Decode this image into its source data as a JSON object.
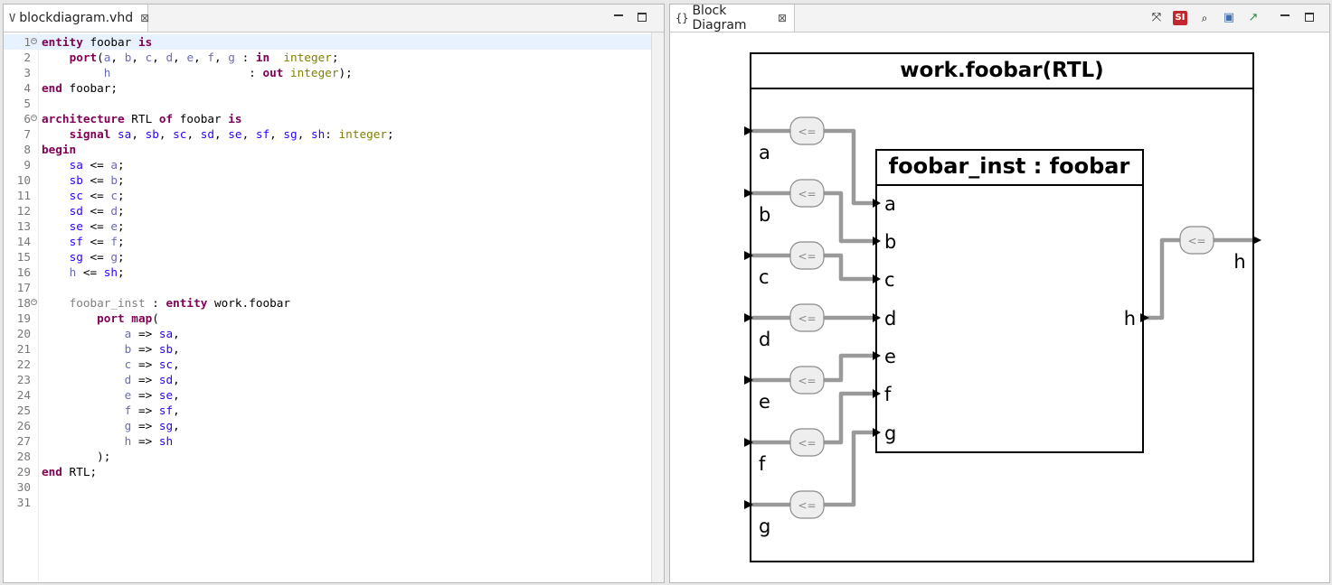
{
  "left_editor": {
    "tab": {
      "title": "blockdiagram.vhd",
      "icon": "vhdl-file-icon"
    },
    "lines": [
      {
        "n": "1",
        "t": [
          [
            "entity",
            "kw"
          ],
          [
            " foobar ",
            ""
          ],
          [
            "is",
            "kw"
          ]
        ]
      },
      {
        "n": "2",
        "t": [
          [
            "    ",
            ""
          ],
          [
            "port",
            "kw"
          ],
          [
            "(",
            ""
          ],
          [
            "a",
            "prt"
          ],
          [
            ", ",
            ""
          ],
          [
            "b",
            "prt"
          ],
          [
            ", ",
            ""
          ],
          [
            "c",
            "prt"
          ],
          [
            ", ",
            ""
          ],
          [
            "d",
            "prt"
          ],
          [
            ", ",
            ""
          ],
          [
            "e",
            "prt"
          ],
          [
            ", ",
            ""
          ],
          [
            "f",
            "prt"
          ],
          [
            ", ",
            ""
          ],
          [
            "g",
            "prt"
          ],
          [
            " : ",
            ""
          ],
          [
            "in",
            "kw"
          ],
          [
            "  ",
            ""
          ],
          [
            "integer",
            "typ"
          ],
          [
            ";",
            ""
          ]
        ]
      },
      {
        "n": "3",
        "t": [
          [
            "         ",
            ""
          ],
          [
            "h",
            "prt"
          ],
          [
            "                    : ",
            ""
          ],
          [
            "out",
            "kw"
          ],
          [
            " ",
            ""
          ],
          [
            "integer",
            "typ"
          ],
          [
            ");",
            ""
          ]
        ]
      },
      {
        "n": "4",
        "t": [
          [
            "end",
            "kw"
          ],
          [
            " foobar;",
            ""
          ]
        ]
      },
      {
        "n": "5",
        "t": []
      },
      {
        "n": "6",
        "t": [
          [
            "architecture",
            "kw"
          ],
          [
            " RTL ",
            ""
          ],
          [
            "of",
            "kw"
          ],
          [
            " foobar ",
            ""
          ],
          [
            "is",
            "kw"
          ]
        ]
      },
      {
        "n": "7",
        "t": [
          [
            "    ",
            ""
          ],
          [
            "signal",
            "kw"
          ],
          [
            " ",
            ""
          ],
          [
            "sa",
            "sig"
          ],
          [
            ", ",
            ""
          ],
          [
            "sb",
            "sig"
          ],
          [
            ", ",
            ""
          ],
          [
            "sc",
            "sig"
          ],
          [
            ", ",
            ""
          ],
          [
            "sd",
            "sig"
          ],
          [
            ", ",
            ""
          ],
          [
            "se",
            "sig"
          ],
          [
            ", ",
            ""
          ],
          [
            "sf",
            "sig"
          ],
          [
            ", ",
            ""
          ],
          [
            "sg",
            "sig"
          ],
          [
            ", ",
            ""
          ],
          [
            "sh",
            "sig"
          ],
          [
            ": ",
            ""
          ],
          [
            "integer",
            "typ"
          ],
          [
            ";",
            ""
          ]
        ]
      },
      {
        "n": "8",
        "t": [
          [
            "begin",
            "kw"
          ]
        ]
      },
      {
        "n": "9",
        "t": [
          [
            "    ",
            ""
          ],
          [
            "sa",
            "sig"
          ],
          [
            " <= ",
            ""
          ],
          [
            "a",
            "prt"
          ],
          [
            ";",
            ""
          ]
        ]
      },
      {
        "n": "10",
        "t": [
          [
            "    ",
            ""
          ],
          [
            "sb",
            "sig"
          ],
          [
            " <= ",
            ""
          ],
          [
            "b",
            "prt"
          ],
          [
            ";",
            ""
          ]
        ]
      },
      {
        "n": "11",
        "t": [
          [
            "    ",
            ""
          ],
          [
            "sc",
            "sig"
          ],
          [
            " <= ",
            ""
          ],
          [
            "c",
            "prt"
          ],
          [
            ";",
            ""
          ]
        ]
      },
      {
        "n": "12",
        "t": [
          [
            "    ",
            ""
          ],
          [
            "sd",
            "sig"
          ],
          [
            " <= ",
            ""
          ],
          [
            "d",
            "prt"
          ],
          [
            ";",
            ""
          ]
        ]
      },
      {
        "n": "13",
        "t": [
          [
            "    ",
            ""
          ],
          [
            "se",
            "sig"
          ],
          [
            " <= ",
            ""
          ],
          [
            "e",
            "prt"
          ],
          [
            ";",
            ""
          ]
        ]
      },
      {
        "n": "14",
        "t": [
          [
            "    ",
            ""
          ],
          [
            "sf",
            "sig"
          ],
          [
            " <= ",
            ""
          ],
          [
            "f",
            "prt"
          ],
          [
            ";",
            ""
          ]
        ]
      },
      {
        "n": "15",
        "t": [
          [
            "    ",
            ""
          ],
          [
            "sg",
            "sig"
          ],
          [
            " <= ",
            ""
          ],
          [
            "g",
            "prt"
          ],
          [
            ";",
            ""
          ]
        ]
      },
      {
        "n": "16",
        "t": [
          [
            "    ",
            ""
          ],
          [
            "h",
            "prt"
          ],
          [
            " <= ",
            ""
          ],
          [
            "sh",
            "sig"
          ],
          [
            ";",
            ""
          ]
        ]
      },
      {
        "n": "17",
        "t": []
      },
      {
        "n": "18",
        "t": [
          [
            "    ",
            ""
          ],
          [
            "foobar_inst",
            "lbl"
          ],
          [
            " : ",
            ""
          ],
          [
            "entity",
            "kw"
          ],
          [
            " work.foobar",
            ""
          ]
        ]
      },
      {
        "n": "19",
        "t": [
          [
            "        ",
            ""
          ],
          [
            "port map",
            "kw"
          ],
          [
            "(",
            ""
          ]
        ]
      },
      {
        "n": "20",
        "t": [
          [
            "            ",
            ""
          ],
          [
            "a",
            "prt"
          ],
          [
            " => ",
            ""
          ],
          [
            "sa",
            "sig"
          ],
          [
            ",",
            ""
          ]
        ]
      },
      {
        "n": "21",
        "t": [
          [
            "            ",
            ""
          ],
          [
            "b",
            "prt"
          ],
          [
            " => ",
            ""
          ],
          [
            "sb",
            "sig"
          ],
          [
            ",",
            ""
          ]
        ]
      },
      {
        "n": "22",
        "t": [
          [
            "            ",
            ""
          ],
          [
            "c",
            "prt"
          ],
          [
            " => ",
            ""
          ],
          [
            "sc",
            "sig"
          ],
          [
            ",",
            ""
          ]
        ]
      },
      {
        "n": "23",
        "t": [
          [
            "            ",
            ""
          ],
          [
            "d",
            "prt"
          ],
          [
            " => ",
            ""
          ],
          [
            "sd",
            "sig"
          ],
          [
            ",",
            ""
          ]
        ]
      },
      {
        "n": "24",
        "t": [
          [
            "            ",
            ""
          ],
          [
            "e",
            "prt"
          ],
          [
            " => ",
            ""
          ],
          [
            "se",
            "sig"
          ],
          [
            ",",
            ""
          ]
        ]
      },
      {
        "n": "25",
        "t": [
          [
            "            ",
            ""
          ],
          [
            "f",
            "prt"
          ],
          [
            " => ",
            ""
          ],
          [
            "sf",
            "sig"
          ],
          [
            ",",
            ""
          ]
        ]
      },
      {
        "n": "26",
        "t": [
          [
            "            ",
            ""
          ],
          [
            "g",
            "prt"
          ],
          [
            " => ",
            ""
          ],
          [
            "sg",
            "sig"
          ],
          [
            ",",
            ""
          ]
        ]
      },
      {
        "n": "27",
        "t": [
          [
            "            ",
            ""
          ],
          [
            "h",
            "prt"
          ],
          [
            " => ",
            ""
          ],
          [
            "sh",
            "sig"
          ]
        ]
      },
      {
        "n": "28",
        "t": [
          [
            "        );",
            ""
          ]
        ]
      },
      {
        "n": "29",
        "t": [
          [
            "end",
            "kw"
          ],
          [
            " RTL;",
            ""
          ]
        ]
      },
      {
        "n": "30",
        "t": []
      },
      {
        "n": "31",
        "t": []
      }
    ],
    "foldable_lines": [
      "1",
      "6",
      "18"
    ],
    "current_line": "1"
  },
  "right_view": {
    "tab": {
      "title": "Block Diagram",
      "icon": "block-diagram-icon"
    },
    "toolbar": [
      {
        "name": "fit-to-view-icon",
        "glyph": "⤧"
      },
      {
        "name": "sigasi-icon",
        "glyph": "SI"
      },
      {
        "name": "zoom-icon",
        "glyph": "🔍"
      },
      {
        "name": "save-icon",
        "glyph": "💾"
      },
      {
        "name": "export-icon",
        "glyph": "↗"
      }
    ],
    "diagram": {
      "title": "work.foobar(RTL)",
      "inputs": [
        "a",
        "b",
        "c",
        "d",
        "e",
        "f",
        "g"
      ],
      "output": "h",
      "instance": {
        "label": "foobar_inst : foobar",
        "inputs": [
          "a",
          "b",
          "c",
          "d",
          "e",
          "f",
          "g"
        ],
        "output": "h"
      },
      "assign_label": "<=",
      "colors": {
        "wire": "#9a9a9a",
        "assign_fill": "#eeeeee",
        "assign_stroke": "#8c8c8c",
        "border": "#000000"
      }
    }
  },
  "colors": {
    "keyword": "#7f0055",
    "signal": "#2a00ff",
    "port": "#6b6bb4",
    "type": "#808000",
    "label": "#808080"
  }
}
